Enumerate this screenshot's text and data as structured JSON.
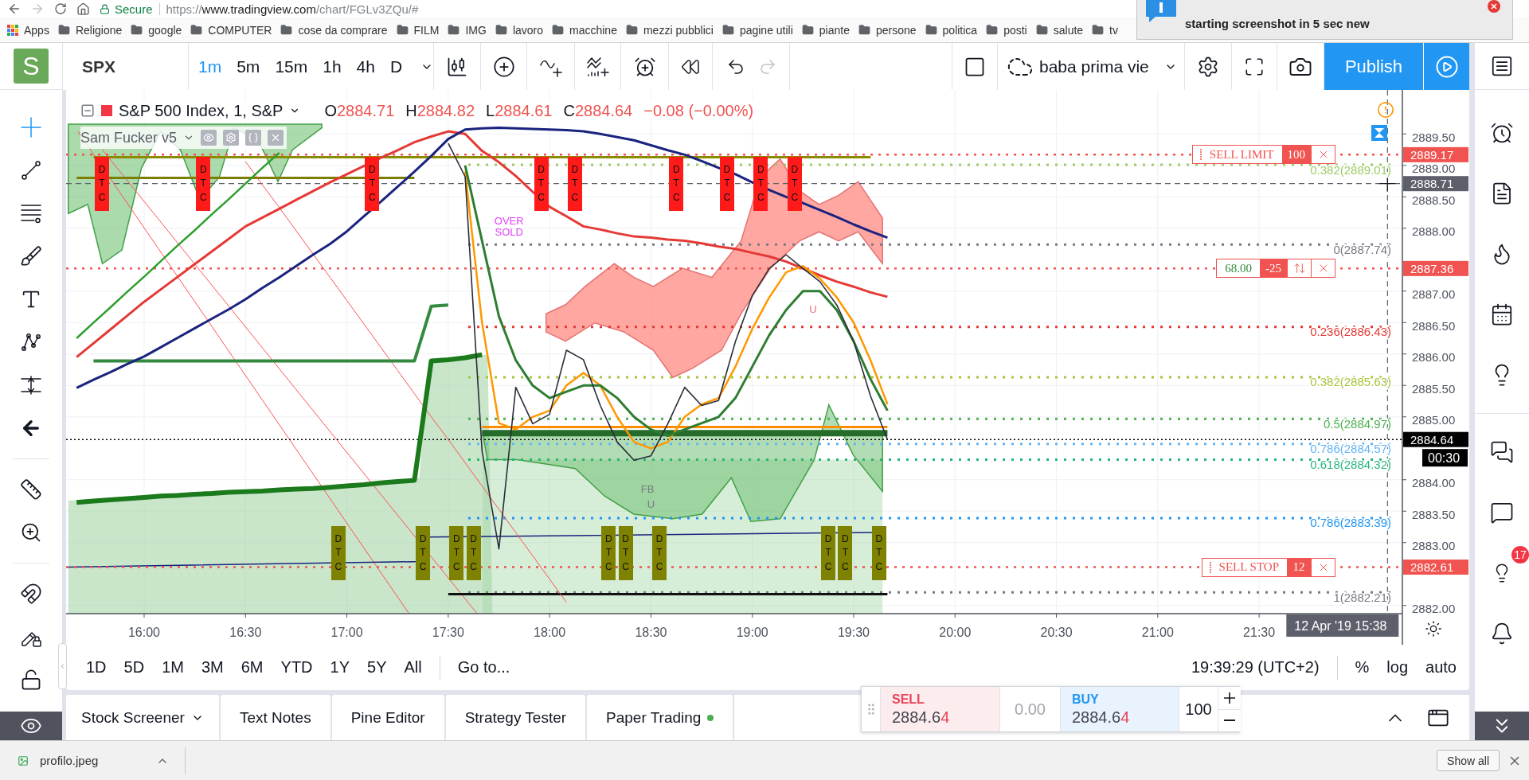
{
  "browser": {
    "forward_disabled": true,
    "secure_label": "Secure",
    "url": {
      "scheme": "https://",
      "host": "www.tradingview.com",
      "path": "/chart/FGLv3ZQu/#"
    },
    "bookmarks": [
      {
        "kind": "apps",
        "label": "Apps"
      },
      {
        "kind": "folder",
        "label": "Religione"
      },
      {
        "kind": "folder",
        "label": "google"
      },
      {
        "kind": "folder",
        "label": "COMPUTER"
      },
      {
        "kind": "folder",
        "label": "cose da comprare"
      },
      {
        "kind": "folder",
        "label": "FILM"
      },
      {
        "kind": "folder",
        "label": "IMG"
      },
      {
        "kind": "folder",
        "label": "lavoro"
      },
      {
        "kind": "folder",
        "label": "macchine"
      },
      {
        "kind": "folder",
        "label": "mezzi pubblici"
      },
      {
        "kind": "folder",
        "label": "pagine utili"
      },
      {
        "kind": "folder",
        "label": "piante"
      },
      {
        "kind": "folder",
        "label": "persone"
      },
      {
        "kind": "folder",
        "label": "politica"
      },
      {
        "kind": "folder",
        "label": "posti"
      },
      {
        "kind": "folder",
        "label": "salute"
      },
      {
        "kind": "folder",
        "label": "tv"
      }
    ]
  },
  "notification": {
    "text": "starting screenshot in 5 sec new"
  },
  "toolbar": {
    "avatar": "S",
    "symbol": "SPX",
    "intervals": [
      {
        "label": "1m",
        "selected": true
      },
      {
        "label": "5m",
        "selected": false
      },
      {
        "label": "15m",
        "selected": false
      },
      {
        "label": "1h",
        "selected": false
      },
      {
        "label": "4h",
        "selected": false
      },
      {
        "label": "D",
        "selected": false
      }
    ],
    "redo_disabled": true,
    "layout_name": "baba prima vie",
    "publish": "Publish"
  },
  "drawing_tools": {
    "groups": [
      {
        "tools": [
          {
            "kind": "crosshair",
            "selected": true
          },
          {
            "kind": "trend-line",
            "selected": false
          },
          {
            "kind": "fib",
            "selected": false
          },
          {
            "kind": "brush",
            "selected": false
          },
          {
            "kind": "text",
            "selected": false
          },
          {
            "kind": "pattern",
            "selected": false
          },
          {
            "kind": "prediction",
            "selected": false
          },
          {
            "kind": "arrow",
            "selected": false
          }
        ]
      },
      {
        "tools": [
          {
            "kind": "ruler",
            "selected": false
          },
          {
            "kind": "zoom",
            "selected": false
          }
        ]
      },
      {
        "tools": [
          {
            "kind": "magnet",
            "selected": false
          },
          {
            "kind": "lock-drawing",
            "selected": false
          },
          {
            "kind": "lock",
            "selected": false
          }
        ]
      }
    ],
    "visibility_toggle": {
      "kind": "eye"
    }
  },
  "chart": {
    "legend": {
      "title": "S&P 500 Index, 1, S&P",
      "ohlc": [
        {
          "label": "O",
          "value": "2884.71"
        },
        {
          "label": "H",
          "value": "2884.82"
        },
        {
          "label": "L",
          "value": "2884.61"
        },
        {
          "label": "C",
          "value": "2884.64"
        }
      ],
      "change": "−0.08 (−0.00%)",
      "indicator": "Sam Fucker v5"
    },
    "chart_data": {
      "type": "line",
      "grid": true,
      "x": [
        940,
        945,
        950,
        955,
        960,
        965,
        970,
        975,
        980,
        985,
        990,
        995,
        1000,
        1005,
        1010,
        1015,
        1020,
        1025,
        1030,
        1035,
        1040,
        1045,
        1050,
        1055,
        1060,
        1065,
        1070,
        1075,
        1080,
        1085,
        1090,
        1095,
        1100,
        1105,
        1110,
        1115,
        1120,
        1125,
        1130,
        1135,
        1140,
        1145,
        1150,
        1155,
        1160,
        1165,
        1170,
        1175,
        1180
      ],
      "series": [
        {
          "color": "#2a2e39",
          "values": [
            null,
            null,
            null,
            null,
            null,
            null,
            null,
            null,
            null,
            null,
            null,
            null,
            null,
            null,
            null,
            null,
            null,
            null,
            null,
            null,
            null,
            null,
            2889.35,
            2888.82,
            2884.46,
            2882.9,
            2885.47,
            2884.89,
            2885.04,
            2886.06,
            2885.91,
            2885.18,
            2884.6,
            2884.31,
            2884.38,
            2884.89,
            2885.47,
            2885.18,
            2885.26,
            2886.2,
            2886.93,
            2887.36,
            2887.58,
            2887.36,
            2887.15,
            2886.78,
            2886.2,
            2885.33,
            2884.64
          ]
        },
        {
          "color": "#e53935",
          "values": [
            2885.95,
            2886.17,
            2886.39,
            2886.61,
            2886.83,
            2887.03,
            2887.23,
            2887.43,
            2887.63,
            2887.83,
            2888.03,
            2888.17,
            2888.31,
            2888.45,
            2888.59,
            2888.73,
            2888.86,
            2888.99,
            2889.12,
            2889.24,
            2889.37,
            2889.46,
            2889.54,
            2889.5,
            2889.23,
            2889.05,
            2888.83,
            2888.58,
            2888.34,
            2888.19,
            2888.03,
            2887.98,
            2887.92,
            2887.87,
            2887.85,
            2887.82,
            2887.8,
            2887.76,
            2887.71,
            2887.67,
            2887.61,
            2887.55,
            2887.47,
            2887.36,
            2887.25,
            2887.15,
            2887.07,
            2886.98,
            2886.91
          ]
        },
        {
          "color": "#1a237e",
          "values": [
            2885.46,
            2885.59,
            2885.71,
            2885.84,
            2885.96,
            2886.11,
            2886.26,
            2886.41,
            2886.56,
            2886.71,
            2886.87,
            2887.05,
            2887.22,
            2887.4,
            2887.58,
            2887.75,
            2887.95,
            2888.19,
            2888.42,
            2888.66,
            2888.9,
            2889.15,
            2889.42,
            2889.57,
            2889.59,
            2889.6,
            2889.59,
            2889.58,
            2889.57,
            2889.56,
            2889.54,
            2889.5,
            2889.45,
            2889.4,
            2889.32,
            2889.24,
            2889.17,
            2889.07,
            2888.96,
            2888.86,
            2888.73,
            2888.61,
            2888.5,
            2888.4,
            2888.29,
            2888.18,
            2888.06,
            2887.95,
            2887.85
          ]
        },
        {
          "color": "#ff9800",
          "values": [
            null,
            null,
            null,
            null,
            null,
            null,
            null,
            null,
            null,
            null,
            null,
            null,
            null,
            null,
            null,
            null,
            null,
            null,
            null,
            null,
            null,
            null,
            null,
            2888.9,
            2886.5,
            2884.9,
            2884.8,
            2885.0,
            2885.1,
            2885.5,
            2885.7,
            2885.5,
            2885.0,
            2884.6,
            2884.5,
            2884.6,
            2885.0,
            2885.2,
            2885.3,
            2885.8,
            2886.4,
            2886.9,
            2887.3,
            2887.4,
            2887.2,
            2886.9,
            2886.5,
            2885.9,
            2885.2
          ]
        },
        {
          "color": "#2e7d32",
          "values": [
            null,
            null,
            null,
            null,
            null,
            null,
            null,
            null,
            null,
            null,
            null,
            null,
            null,
            null,
            null,
            null,
            null,
            null,
            null,
            null,
            null,
            null,
            null,
            2889.0,
            2887.8,
            2886.6,
            2885.9,
            2885.5,
            2885.3,
            2885.4,
            2885.5,
            2885.5,
            2885.3,
            2885.0,
            2884.8,
            2884.7,
            2884.8,
            2884.9,
            2885.0,
            2885.3,
            2885.8,
            2886.3,
            2886.7,
            2887.0,
            2887.0,
            2886.7,
            2886.2,
            2885.6,
            2885.1
          ]
        },
        {
          "color": "#ff5252",
          "values": [
            null,
            null,
            null,
            null,
            null,
            null,
            null,
            null,
            null,
            null,
            2889.06,
            2888.69,
            2888.33,
            2887.96,
            2887.59,
            2887.22,
            2886.85,
            2886.48,
            2886.11,
            2885.74,
            2885.37,
            2885.0,
            2884.64,
            2884.27,
            2883.9,
            2883.53,
            2883.16,
            2882.79,
            2882.42,
            2882.05,
            null,
            null,
            null,
            null,
            null,
            null,
            null,
            null,
            null,
            null,
            null,
            null,
            null,
            null,
            null,
            null,
            null,
            null,
            null
          ]
        },
        {
          "color": "#1b7a1b",
          "values": [
            2883.64,
            2883.66,
            2883.68,
            2883.7,
            2883.72,
            2883.74,
            2883.75,
            2883.77,
            2883.78,
            2883.8,
            2883.81,
            2883.82,
            2883.84,
            2883.85,
            2883.86,
            2883.88,
            2883.9,
            2883.92,
            2883.95,
            2883.97,
            2883.99,
            2885.89,
            2885.91,
            2885.94,
            2885.99,
            null,
            null,
            null,
            null,
            null,
            null,
            null,
            null,
            null,
            null,
            null,
            null,
            null,
            null,
            null,
            null,
            null,
            null,
            null,
            null,
            null,
            null,
            null,
            null
          ]
        },
        {
          "color": "#338a3e",
          "values": [
            null,
            2885.89,
            2885.89,
            2885.89,
            2885.89,
            2885.89,
            2885.89,
            2885.89,
            2885.89,
            2885.89,
            2885.89,
            2885.89,
            2885.89,
            2885.89,
            2885.89,
            2885.89,
            2885.89,
            2885.89,
            2885.89,
            2885.89,
            2885.89,
            2886.76,
            2886.78,
            null,
            null,
            null,
            null,
            null,
            null,
            null,
            null,
            null,
            null,
            null,
            null,
            null,
            null,
            null,
            null,
            null,
            null,
            null,
            null,
            null,
            null,
            null,
            null,
            null,
            null
          ]
        },
        {
          "color": "#2e9e2e",
          "values": [
            2886.25,
            2886.5,
            2886.74,
            2886.99,
            2887.23,
            2887.48,
            2887.73,
            2887.97,
            2888.22,
            2888.46,
            2888.71,
            2888.96,
            2889.2,
            null,
            null,
            null,
            null,
            null,
            null,
            null,
            null,
            null,
            null,
            null,
            null,
            null,
            null,
            null,
            null,
            null,
            null,
            null,
            null,
            null,
            null,
            null,
            null,
            null,
            null,
            null,
            null,
            null,
            null,
            null,
            null,
            null,
            null,
            null,
            null
          ]
        },
        {
          "color": "#8b8b00",
          "values": [
            null,
            2889.13,
            2889.13,
            2889.13,
            2889.13,
            2889.13,
            2889.13,
            2889.13,
            2889.13,
            2889.13,
            2889.13,
            2889.13,
            2889.13,
            2889.13,
            2889.13,
            2889.13,
            2889.13,
            2889.13,
            2889.13,
            2889.13,
            2889.13,
            2889.13,
            2889.13,
            2889.13,
            2889.13,
            2889.13,
            2889.13,
            2889.13,
            2889.13,
            2889.13,
            2889.13,
            2889.13,
            2889.13,
            2889.13,
            2889.13,
            2889.13,
            2889.13,
            2889.13,
            2889.13,
            2889.13,
            2889.13,
            2889.13,
            2889.13,
            2889.13,
            2889.13,
            2889.13,
            2889.13,
            2889.13,
            null
          ]
        },
        {
          "color": "#7d7d00",
          "values": [
            2888.8,
            2888.8,
            2888.8,
            2888.8,
            2888.8,
            2888.8,
            2888.8,
            2888.8,
            2888.8,
            2888.8,
            2888.8,
            2888.8,
            2888.8,
            2888.8,
            2888.8,
            2888.8,
            2888.8,
            2888.8,
            2888.8,
            2888.8,
            2888.8,
            null,
            null,
            null,
            null,
            null,
            null,
            null,
            null,
            null,
            null,
            null,
            null,
            null,
            null,
            null,
            null,
            null,
            null,
            null,
            null,
            null,
            null,
            null,
            null,
            null,
            null,
            null,
            null
          ]
        },
        {
          "color": "#256b2a",
          "values": [
            null,
            null,
            null,
            null,
            null,
            null,
            null,
            null,
            null,
            null,
            null,
            null,
            null,
            null,
            null,
            null,
            null,
            null,
            null,
            null,
            null,
            null,
            null,
            null,
            2884.74,
            2884.74,
            2884.74,
            2884.74,
            2884.74,
            2884.74,
            2884.74,
            2884.74,
            2884.74,
            2884.74,
            2884.74,
            2884.74,
            2884.74,
            2884.74,
            2884.74,
            2884.74,
            2884.74,
            2884.74,
            2884.74,
            2884.74,
            2884.74,
            2884.74,
            2884.74,
            2884.74,
            2884.74
          ]
        },
        {
          "color": "#fb8c00",
          "values": [
            null,
            null,
            null,
            null,
            null,
            null,
            null,
            null,
            null,
            null,
            null,
            null,
            null,
            null,
            null,
            null,
            null,
            null,
            null,
            null,
            null,
            null,
            null,
            null,
            2884.84,
            2884.84,
            2884.84,
            2884.84,
            2884.84,
            2884.84,
            2884.84,
            2884.84,
            2884.84,
            2884.84,
            2884.84,
            2884.84,
            2884.84,
            2884.84,
            2884.84,
            2884.84,
            2884.84,
            2884.84,
            2884.84,
            2884.84,
            2884.84,
            2884.84,
            2884.84,
            2884.84,
            2884.84
          ]
        },
        {
          "color": "#111111",
          "values": [
            null,
            null,
            null,
            null,
            null,
            null,
            null,
            null,
            null,
            null,
            null,
            null,
            null,
            null,
            null,
            null,
            null,
            null,
            null,
            null,
            null,
            null,
            2882.18,
            2882.18,
            2882.18,
            2882.18,
            2882.18,
            2882.18,
            2882.18,
            2882.18,
            2882.18,
            2882.18,
            2882.18,
            2882.18,
            2882.18,
            2882.18,
            2882.18,
            2882.18,
            2882.18,
            2882.18,
            2882.18,
            2882.18,
            2882.18,
            2882.18,
            2882.18,
            2882.18,
            2882.18,
            2882.18,
            2882.18
          ]
        }
      ],
      "xlim": [
        936.9,
        1332.4
      ],
      "ylim": [
        2881.87,
        2890.2
      ],
      "xticks": [
        {
          "value": 960,
          "label": "16:00"
        },
        {
          "value": 990,
          "label": "16:30"
        },
        {
          "value": 1020,
          "label": "17:00"
        },
        {
          "value": 1050,
          "label": "17:30"
        },
        {
          "value": 1080,
          "label": "18:00"
        },
        {
          "value": 1110,
          "label": "18:30"
        },
        {
          "value": 1140,
          "label": "19:00"
        },
        {
          "value": 1170,
          "label": "19:30"
        },
        {
          "value": 1200,
          "label": "20:00"
        },
        {
          "value": 1230,
          "label": "20:30"
        },
        {
          "value": 1260,
          "label": "21:00"
        },
        {
          "value": 1290,
          "label": "21:30"
        }
      ],
      "yticks": [
        {
          "value": 2889.5,
          "label": "2889.50"
        },
        {
          "value": 2889,
          "label": "2889.00"
        },
        {
          "value": 2888.5,
          "label": "2888.50"
        },
        {
          "value": 2888,
          "label": "2888.00"
        },
        {
          "value": 2887,
          "label": "2887.00"
        },
        {
          "value": 2886.5,
          "label": "2886.50"
        },
        {
          "value": 2886,
          "label": "2886.00"
        },
        {
          "value": 2885.5,
          "label": "2885.50"
        },
        {
          "value": 2885,
          "label": "2885.00"
        },
        {
          "value": 2884,
          "label": "2884.00"
        },
        {
          "value": 2883.5,
          "label": "2883.50"
        },
        {
          "value": 2883,
          "label": "2883.00"
        },
        {
          "value": 2882,
          "label": "2882.00"
        }
      ],
      "ref_lines": [
        {
          "axis": "y",
          "value": 2889.17,
          "label": "2889.17",
          "color": "#f05350"
        },
        {
          "axis": "y",
          "value": 2887.36,
          "label": "2887.36",
          "color": "#f05350"
        },
        {
          "axis": "y",
          "value": 2884.64,
          "label": "2884.64",
          "color": "#000000"
        },
        {
          "axis": "y",
          "value": 2882.61,
          "label": "2882.61",
          "color": "#f05350"
        },
        {
          "axis": "y",
          "value": 2888.71,
          "label": "2888.71",
          "color": "#5d606b"
        },
        {
          "axis": "x",
          "value": 1328,
          "color": "#5d606b"
        },
        {
          "axis": "y",
          "value": 2889.01,
          "label": "0.382(2889.01)",
          "color": "#9ccc65"
        },
        {
          "axis": "y",
          "value": 2887.74,
          "label": "0(2887.74)",
          "color": "#787b86"
        },
        {
          "axis": "y",
          "value": 2886.43,
          "label": "0.236(2886.43)",
          "color": "#e53935"
        },
        {
          "axis": "y",
          "value": 2885.63,
          "label": "0.382(2885.63)",
          "color": "#a4c639"
        },
        {
          "axis": "y",
          "value": 2884.97,
          "label": "0.5(2884.97)",
          "color": "#4caf50"
        },
        {
          "axis": "y",
          "value": 2884.57,
          "label": "0.786(2884.57)",
          "color": "#64b5f6"
        },
        {
          "axis": "y",
          "value": 2884.32,
          "label": "0.618(2884.32)",
          "color": "#26b57a"
        },
        {
          "axis": "y",
          "value": 2883.39,
          "label": "0.786(2883.39)",
          "color": "#2196f3"
        },
        {
          "axis": "y",
          "value": 2882.21,
          "label": "1(2882.21)",
          "color": "#787b86"
        }
      ]
    },
    "crosshair_time": "12 Apr '19 15:38",
    "orders": [
      {
        "kind": "order",
        "label": "SELL LIMIT",
        "quantity": "100"
      },
      {
        "kind": "position",
        "pnl": "68.00",
        "quantity": "-25"
      },
      {
        "kind": "order",
        "label": "SELL STOP",
        "quantity": "12"
      }
    ],
    "countdown": "00:30",
    "signals": [
      {
        "kind": "top",
        "text": "DTC"
      },
      {
        "kind": "top",
        "text": "DTC"
      },
      {
        "kind": "top",
        "text": "DTC"
      },
      {
        "kind": "top",
        "text": "DTC"
      },
      {
        "kind": "top",
        "text": "DTC"
      },
      {
        "kind": "top",
        "text": "DTC"
      },
      {
        "kind": "top",
        "text": "DTC"
      },
      {
        "kind": "top",
        "text": "DTC"
      },
      {
        "kind": "top",
        "text": "DTC"
      },
      {
        "kind": "bottom",
        "text": "DTC"
      },
      {
        "kind": "bottom",
        "text": "DTC"
      },
      {
        "kind": "bottom",
        "text": "DTC"
      },
      {
        "kind": "bottom",
        "text": "DTC"
      },
      {
        "kind": "bottom",
        "text": "DTC"
      },
      {
        "kind": "bottom",
        "text": "DTC"
      },
      {
        "kind": "bottom",
        "text": "DTC"
      },
      {
        "kind": "bottom",
        "text": "DTC"
      },
      {
        "kind": "bottom",
        "text": "DTC"
      },
      {
        "kind": "bottom",
        "text": "DTC"
      }
    ],
    "labels": [
      {
        "text": "OVER SOLD",
        "color": "#e040fb"
      },
      {
        "text": "FB",
        "color": "#787b86"
      },
      {
        "text": "U",
        "color": "#787b86"
      },
      {
        "text": "U",
        "color": "#e57373"
      }
    ]
  },
  "date_ranges": [
    "1D",
    "5D",
    "1M",
    "3M",
    "6M",
    "YTD",
    "1Y",
    "5Y",
    "All"
  ],
  "goto": "Go to...",
  "clock": "19:39:29 (UTC+2)",
  "scale_options": [
    "%",
    "log",
    "auto"
  ],
  "bottom_tabs": [
    {
      "label": "Stock Screener",
      "kind": "dropdown"
    },
    {
      "label": "Text Notes",
      "kind": "plain"
    },
    {
      "label": "Pine Editor",
      "kind": "plain"
    },
    {
      "label": "Strategy Tester",
      "kind": "plain"
    },
    {
      "label": "Paper Trading",
      "kind": "status"
    }
  ],
  "trade_panel": {
    "sell": {
      "label": "SELL",
      "price": "2884.6",
      "price_last": "4"
    },
    "spread": "0.00",
    "buy": {
      "label": "BUY",
      "price": "2884.6",
      "price_last": "4"
    },
    "quantity": "100"
  },
  "right_sidebar": {
    "badge": "17"
  },
  "downloads": {
    "file": "profilo.jpeg",
    "show_all": "Show all"
  }
}
